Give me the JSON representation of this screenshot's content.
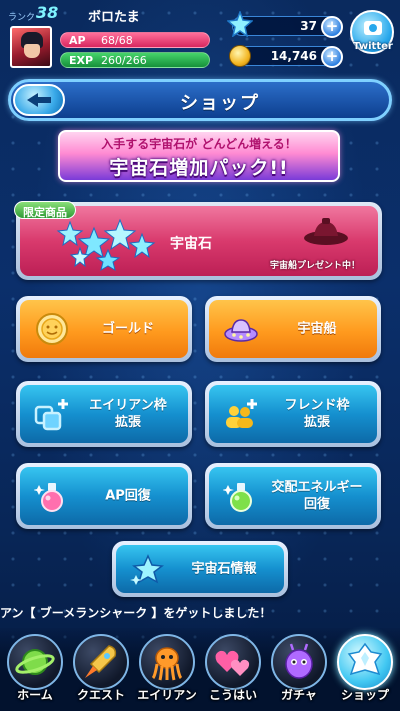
{
  "header": {
    "rank_label": "ランク",
    "rank_value": "38",
    "player_name": "ボロたま",
    "ap_label": "AP",
    "ap_value": "68/68",
    "ap_fraction": 1.0,
    "exp_label": "EXP",
    "exp_value": "260/266",
    "exp_fraction": 0.977,
    "gems": "37",
    "coins": "14,746",
    "twitter_label": "Twitter"
  },
  "title": "ショップ",
  "banner": {
    "top_text": "入手する宇宙石が どんどん増える！",
    "main_text": "宇宙石増加パック!!"
  },
  "limited": {
    "tag": "限定商品",
    "label": "宇宙石",
    "present_text": "宇宙船プレゼント中！"
  },
  "buttons": {
    "gold": "ゴールド",
    "ship": "宇宙船",
    "alien_line1": "エイリアン枠",
    "alien_line2": "拡張",
    "friend_line1": "フレンド枠",
    "friend_line2": "拡張",
    "ap": "AP回復",
    "energy_line1": "交配エネルギー",
    "energy_line2": "回復",
    "info": "宇宙石情報"
  },
  "ticker": "アン【 ブーメランシャーク 】をゲットしました！",
  "nav": [
    {
      "label": "ホーム",
      "icon": "planet-icon"
    },
    {
      "label": "クエスト",
      "icon": "rocket-icon"
    },
    {
      "label": "エイリアン",
      "icon": "octopus-icon"
    },
    {
      "label": "こうはい",
      "icon": "hearts-icon"
    },
    {
      "label": "ガチャ",
      "icon": "alien-egg-icon"
    },
    {
      "label": "ショップ",
      "icon": "crystal-icon"
    }
  ],
  "colors": {
    "accent": "#42c8f2",
    "orange_button": "#ff9a1e",
    "blue_button": "#1590cf",
    "limited_pink": "#d93a6d",
    "ap_bar": "#d8275f",
    "exp_bar": "#16913a"
  }
}
